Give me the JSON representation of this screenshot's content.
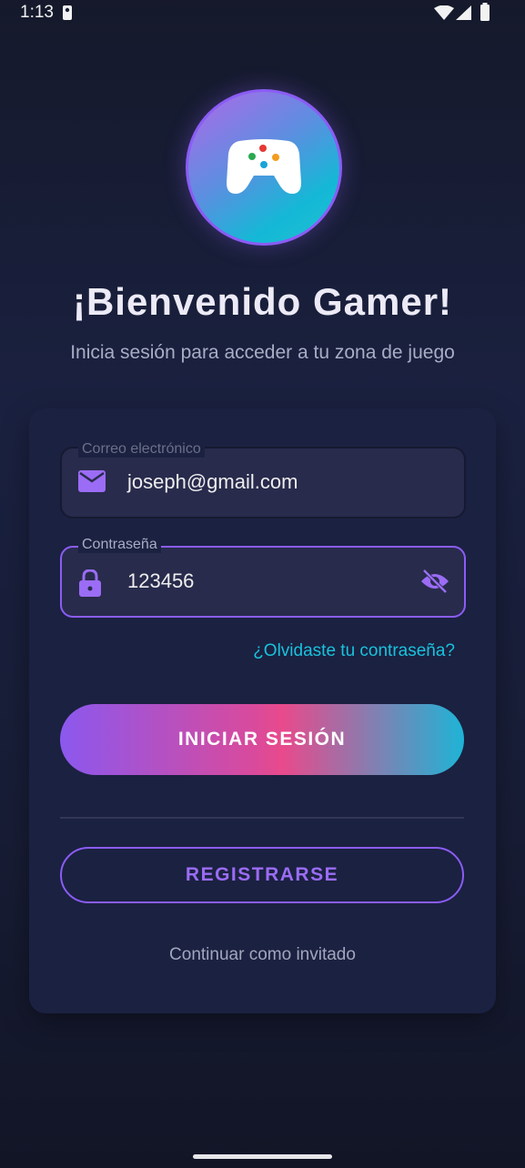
{
  "status_bar": {
    "time": "1:13"
  },
  "header": {
    "title": "¡Bienvenido Gamer!",
    "subtitle": "Inicia sesión para acceder a tu zona de juego"
  },
  "form": {
    "email": {
      "label": "Correo electrónico",
      "value": "joseph@gmail.com",
      "icon": "mail-icon"
    },
    "password": {
      "label": "Contraseña",
      "value": "123456",
      "icon": "lock-icon",
      "toggle_icon": "eye-off-icon"
    },
    "forgot_link": "¿Olvidaste tu contraseña?",
    "login_button": "INICIAR SESIÓN",
    "register_button": "REGISTRARSE",
    "guest_link": "Continuar como invitado"
  },
  "colors": {
    "accent": "#8b5cf6",
    "link": "#19c2dc",
    "gradient_start": "#8b58ee",
    "gradient_mid": "#e84a8c",
    "gradient_end": "#1eb4d6"
  }
}
